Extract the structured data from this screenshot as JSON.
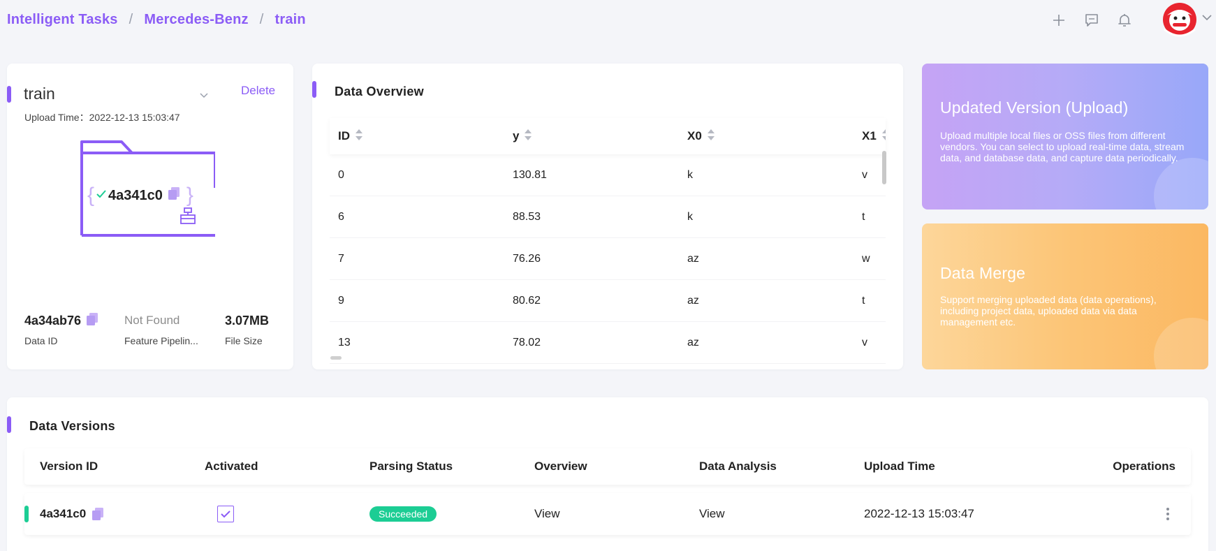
{
  "breadcrumb": [
    "Intelligent Tasks",
    "Mercedes-Benz",
    "train"
  ],
  "header_icons": [
    "plus-icon",
    "chat-icon",
    "bell-icon",
    "avatar",
    "chevron-down-icon"
  ],
  "dataset": {
    "name": "train",
    "delete_label": "Delete",
    "upload_time": "Upload Time：2022-12-13  15:03:47",
    "folder_hash": "4a341c0",
    "meta": [
      {
        "value": "4a34ab76",
        "label": "Data ID"
      },
      {
        "value": "Not Found",
        "label": "Feature Pipelin..."
      },
      {
        "value": "3.07MB",
        "label": "File Size"
      }
    ]
  },
  "overview": {
    "title": "Data Overview",
    "columns": [
      "ID",
      "y",
      "X0",
      "X1"
    ],
    "rows": [
      [
        "0",
        "130.81",
        "k",
        "v"
      ],
      [
        "6",
        "88.53",
        "k",
        "t"
      ],
      [
        "7",
        "76.26",
        "az",
        "w"
      ],
      [
        "9",
        "80.62",
        "az",
        "t"
      ],
      [
        "13",
        "78.02",
        "az",
        "v"
      ]
    ]
  },
  "features": {
    "upload": {
      "title": "Updated Version (Upload)",
      "desc": "Upload multiple local files or OSS files from different vendors. You can select to upload real-time data, stream data, and database data, and capture data periodically."
    },
    "merge": {
      "title": "Data Merge",
      "desc": "Support merging uploaded data (data operations), including project data, uploaded data via data management etc."
    }
  },
  "versions": {
    "title": "Data Versions",
    "columns": [
      "Version ID",
      "Activated",
      "Parsing Status",
      "Overview",
      "Data Analysis",
      "Upload Time",
      "Operations"
    ],
    "rows": [
      {
        "id": "4a341c0",
        "activated": true,
        "status": "Succeeded",
        "overview": "View",
        "analysis": "View",
        "upload_time": "2022-12-13  15:03:47"
      }
    ]
  },
  "colors": {
    "accent": "#8b5cf6",
    "success": "#1ccd94",
    "upload_card": "#b5abf7",
    "merge_card": "#fcc577"
  }
}
